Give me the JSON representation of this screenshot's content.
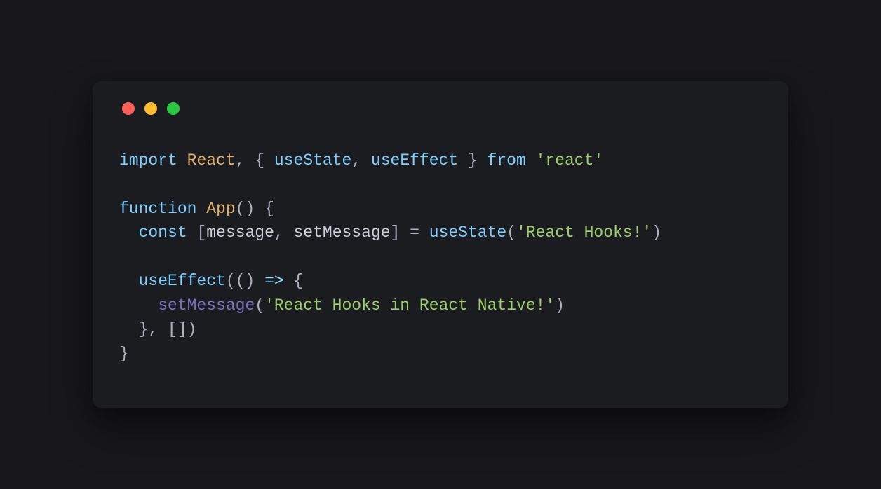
{
  "window": {
    "traffic_lights": [
      "red",
      "yellow",
      "green"
    ]
  },
  "code": {
    "l1": {
      "kw_import": "import",
      "react": "React",
      "comma1": ", ",
      "brace_open": "{ ",
      "useState": "useState",
      "comma2": ", ",
      "useEffect": "useEffect",
      "brace_close": " }",
      "kw_from": " from ",
      "str_react": "'react'"
    },
    "l2": "",
    "l3": {
      "kw_function": "function",
      "space": " ",
      "app": "App",
      "paren": "() {"
    },
    "l4": {
      "indent": "  ",
      "kw_const": "const",
      "sp1": " ",
      "lb": "[",
      "msg": "message",
      "comma": ", ",
      "setmsg": "setMessage",
      "rb": "]",
      "eq": " = ",
      "useState": "useState",
      "lp": "(",
      "str": "'React Hooks!'",
      "rp": ")"
    },
    "l5": "",
    "l6": {
      "indent": "  ",
      "useEffect": "useEffect",
      "lp": "((",
      "rp": ") ",
      "arrow": "=>",
      "brace": " {"
    },
    "l7": {
      "indent": "    ",
      "call": "setMessage",
      "lp": "(",
      "str": "'React Hooks in React Native!'",
      "rp": ")"
    },
    "l8": {
      "indent": "  ",
      "close": "}, [])"
    },
    "l9": {
      "close": "}"
    }
  }
}
